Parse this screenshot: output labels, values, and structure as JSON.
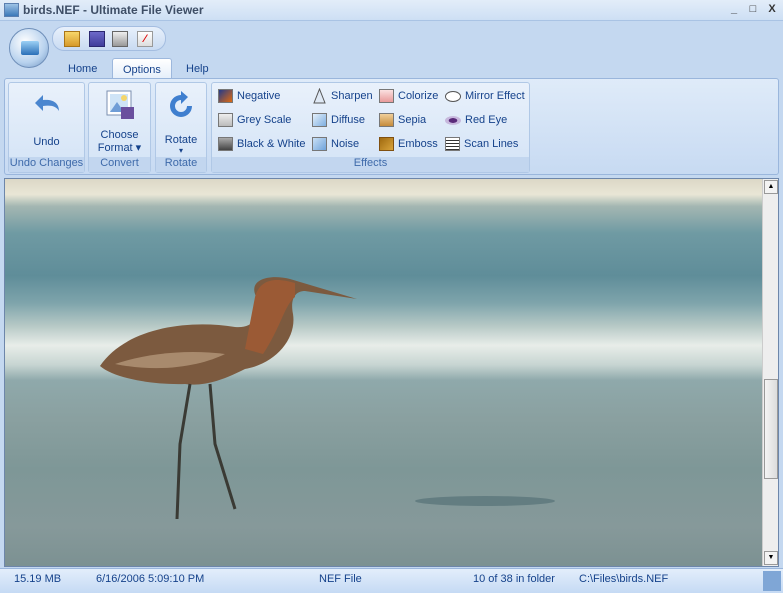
{
  "window": {
    "title": "birds.NEF - Ultimate File Viewer",
    "minimize": "_",
    "maximize": "□",
    "close": "X"
  },
  "quick_access": [
    "open-icon",
    "save-icon",
    "print-icon",
    "pdf-icon"
  ],
  "tabs": [
    {
      "label": "Home"
    },
    {
      "label": "Options"
    },
    {
      "label": "Help"
    }
  ],
  "ribbon": {
    "undo_group": {
      "button": "Undo",
      "label": "Undo Changes"
    },
    "convert_group": {
      "button_line1": "Choose",
      "button_line2": "Format ▾",
      "label": "Convert"
    },
    "rotate_group": {
      "button": "Rotate",
      "arrow": "▾",
      "label": "Rotate"
    },
    "effects_group": {
      "label": "Effects",
      "items": [
        "Negative",
        "Grey Scale",
        "Black & White",
        "Sharpen",
        "Diffuse",
        "Noise",
        "Colorize",
        "Sepia",
        "Emboss",
        "Mirror Effect",
        "Red Eye",
        "Scan Lines"
      ]
    }
  },
  "status": {
    "size": "15.19 MB",
    "date": "6/16/2006 5:09:10 PM",
    "type": "NEF File",
    "position": "10 of 38 in folder",
    "path": "C:\\Files\\birds.NEF"
  }
}
